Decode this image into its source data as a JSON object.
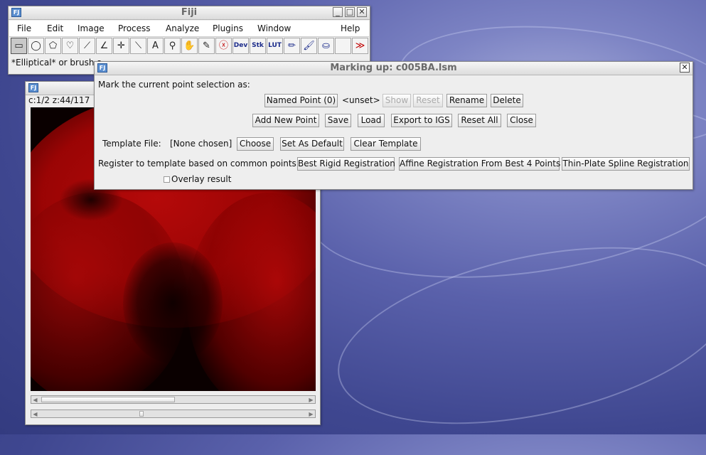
{
  "fiji_window": {
    "title": "Fiji",
    "menus": [
      "File",
      "Edit",
      "Image",
      "Process",
      "Analyze",
      "Plugins",
      "Window",
      "Help"
    ],
    "tools": [
      {
        "name": "rectangle-tool",
        "glyph": "▭"
      },
      {
        "name": "oval-tool",
        "glyph": "◯"
      },
      {
        "name": "polygon-tool",
        "glyph": "⬠"
      },
      {
        "name": "freehand-tool",
        "glyph": "♡"
      },
      {
        "name": "line-tool",
        "glyph": "⟋"
      },
      {
        "name": "angle-tool",
        "glyph": "∠"
      },
      {
        "name": "point-tool",
        "glyph": "✛"
      },
      {
        "name": "wand-tool",
        "glyph": "⟍"
      },
      {
        "name": "text-tool",
        "glyph": "A"
      },
      {
        "name": "zoom-tool",
        "glyph": "⚲"
      },
      {
        "name": "hand-tool",
        "glyph": "✋"
      },
      {
        "name": "dropper-tool",
        "glyph": "✎"
      },
      {
        "name": "stop-tool",
        "glyph": "ⓧ"
      },
      {
        "name": "dev-tool",
        "glyph": "Dev"
      },
      {
        "name": "stk-tool",
        "glyph": "Stk"
      },
      {
        "name": "lut-tool",
        "glyph": "LUT"
      },
      {
        "name": "pencil-tool",
        "glyph": "✏"
      },
      {
        "name": "brush-tool",
        "glyph": "🖌"
      },
      {
        "name": "flood-fill-tool",
        "glyph": "⛀"
      },
      {
        "name": "empty-slot",
        "glyph": ""
      },
      {
        "name": "more-tools",
        "glyph": "≫"
      }
    ],
    "status": "*Elliptical* or brush s"
  },
  "image_window": {
    "info": "c:1/2 z:44/117"
  },
  "dialog": {
    "title": "Marking up: c005BA.lsm",
    "mark_label": "Mark the current point selection as:",
    "named_point": "Named Point (0)",
    "unset": "<unset>",
    "show": "Show",
    "reset": "Reset",
    "rename": "Rename",
    "delete": "Delete",
    "add_new_point": "Add New Point",
    "save": "Save",
    "load": "Load",
    "export_igs": "Export to IGS",
    "reset_all": "Reset All",
    "close": "Close",
    "template_label": "Template File:",
    "template_value": "[None chosen]",
    "choose": "Choose",
    "set_default": "Set As Default",
    "clear_template": "Clear Template",
    "register_label": "Register to template based on common points:",
    "best_rigid": "Best Rigid Registration",
    "affine": "Affine Registration From Best 4 Points",
    "thin_plate": "Thin-Plate Spline Registration",
    "overlay": "Overlay result"
  },
  "colors": {
    "accent_red": "#c00000",
    "image_red": "#d01010"
  }
}
